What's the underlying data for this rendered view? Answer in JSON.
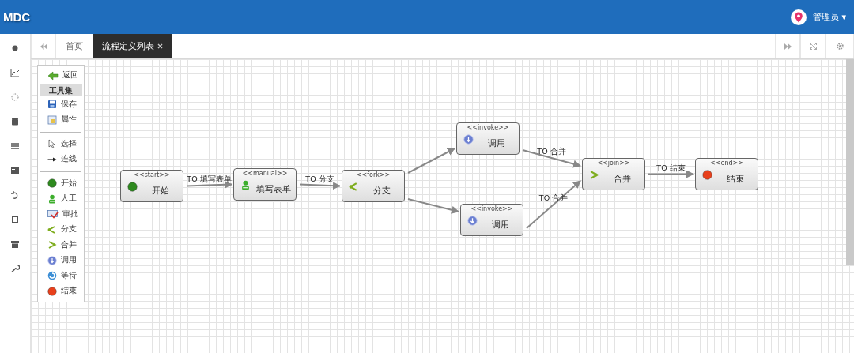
{
  "header": {
    "logo": "MDC",
    "user": "管理员",
    "user_caret": "▾"
  },
  "tabs": [
    {
      "label": "首页",
      "selected": false,
      "closable": false
    },
    {
      "label": "流程定义列表",
      "selected": true,
      "closable": true
    }
  ],
  "palette": {
    "back": {
      "kind": "back",
      "label": "返回"
    },
    "title": "工具集",
    "groups": [
      [
        {
          "kind": "save",
          "label": "保存"
        },
        {
          "kind": "props",
          "label": "属性"
        }
      ],
      [
        {
          "kind": "select",
          "label": "选择"
        },
        {
          "kind": "connect",
          "label": "连线"
        }
      ],
      [
        {
          "kind": "start",
          "label": "开始"
        },
        {
          "kind": "manual",
          "label": "人工"
        },
        {
          "kind": "approve",
          "label": "审批"
        },
        {
          "kind": "fork",
          "label": "分支"
        },
        {
          "kind": "join",
          "label": "合并"
        },
        {
          "kind": "invoke",
          "label": "调用"
        },
        {
          "kind": "wait",
          "label": "等待"
        },
        {
          "kind": "end",
          "label": "结束"
        }
      ]
    ]
  },
  "diagram": {
    "nodes": [
      {
        "kind": "start",
        "stereotype": "<<start>>",
        "label": "开始"
      },
      {
        "kind": "manual",
        "stereotype": "<<manual>>",
        "label": "填写表单"
      },
      {
        "kind": "fork",
        "stereotype": "<<fork>>",
        "label": "分支"
      },
      {
        "kind": "invoke",
        "stereotype": "<<invoke>>",
        "label": "调用"
      },
      {
        "kind": "invoke",
        "stereotype": "<<invoke>>",
        "label": "调用"
      },
      {
        "kind": "join",
        "stereotype": "<<join>>",
        "label": "合并"
      },
      {
        "kind": "end",
        "stereotype": "<<end>>",
        "label": "结束"
      }
    ],
    "edge_labels": [
      {
        "label": "TO 填写表单"
      },
      {
        "label": "TO 分支"
      },
      {
        "label": "TO 合并"
      },
      {
        "label": "TO 合并"
      },
      {
        "label": "TO 结束"
      }
    ]
  }
}
